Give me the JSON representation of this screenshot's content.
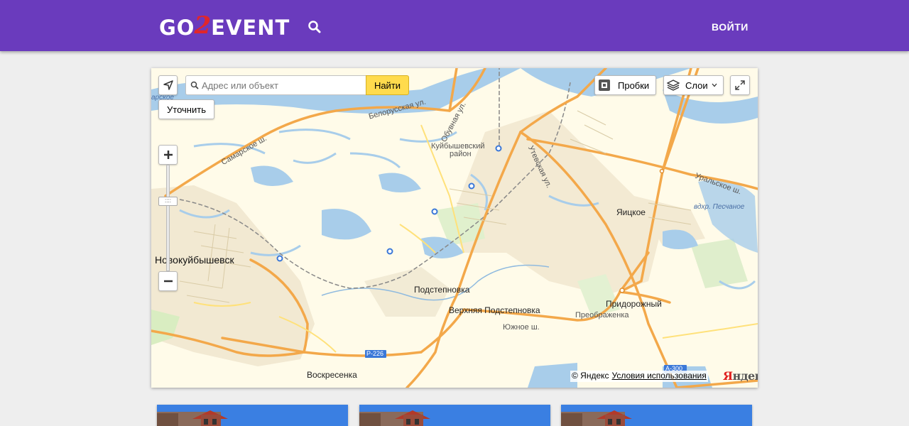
{
  "header": {
    "logo_part1": "GO",
    "logo_part2": "2",
    "logo_part3": "EVENT",
    "login_label": "ВОЙТИ"
  },
  "map": {
    "search_placeholder": "Адрес или объект",
    "find_label": "Найти",
    "refine_label": "Уточнить",
    "traffic_label": "Пробки",
    "layers_label": "Слои",
    "zoom_handle_label": "::::",
    "labels": {
      "novokuibyshevsk": "Новокуйбышевск",
      "podstepnovka": "Подстепновка",
      "verkhnyaya": "Верхняя Подстепновка",
      "yuzhnoe": "Южное ш.",
      "pridorozhny": "Придорожный",
      "preobrazhenka": "Преображенка",
      "yaitskoe": "Яицкое",
      "kuibyshevsky1": "Куйбышевский",
      "kuibyshevsky2": "район",
      "belorusskaya": "Белорусская ул.",
      "obuvnaya": "Обувная ул.",
      "samarskoe": "Самарское ш.",
      "utevskaya": "Утевская ул.",
      "uralskoe": "Уральское ш.",
      "reservoir": "вдхр. Песчаное",
      "voskresenka": "Воскресенка",
      "r226": "Р-226",
      "a300": "А-300",
      "arskoe": "арское"
    },
    "copyright_text": "© Яндекс",
    "terms_label": "Условия использования",
    "logo_y": "Я",
    "logo_rest": "ндекс"
  }
}
